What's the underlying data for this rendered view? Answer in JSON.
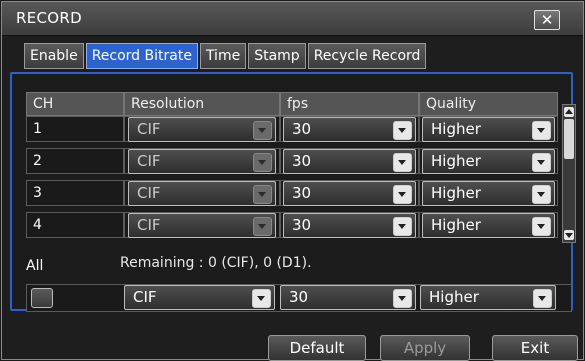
{
  "window": {
    "title": "RECORD",
    "close_glyph": "✕"
  },
  "tabs": [
    {
      "label": "Enable"
    },
    {
      "label": "Record Bitrate"
    },
    {
      "label": "Time"
    },
    {
      "label": "Stamp"
    },
    {
      "label": "Recycle Record"
    }
  ],
  "active_tab": "Record Bitrate",
  "table": {
    "headers": [
      "CH",
      "Resolution",
      "fps",
      "Quality"
    ],
    "rows": [
      {
        "ch": "1",
        "resolution": "CIF",
        "fps": "30",
        "quality": "Higher"
      },
      {
        "ch": "2",
        "resolution": "CIF",
        "fps": "30",
        "quality": "Higher"
      },
      {
        "ch": "3",
        "resolution": "CIF",
        "fps": "30",
        "quality": "Higher"
      },
      {
        "ch": "4",
        "resolution": "CIF",
        "fps": "30",
        "quality": "Higher"
      }
    ]
  },
  "all_row": {
    "label": "All",
    "remaining": "Remaining : 0 (CIF), 0 (D1).",
    "resolution": "CIF",
    "fps": "30",
    "quality": "Higher"
  },
  "buttons": {
    "default": "Default",
    "apply": "Apply",
    "exit": "Exit"
  },
  "colors": {
    "accent": "#2d63cf",
    "panel_border": "#2d5fcf",
    "background": "#1e1e1e"
  }
}
